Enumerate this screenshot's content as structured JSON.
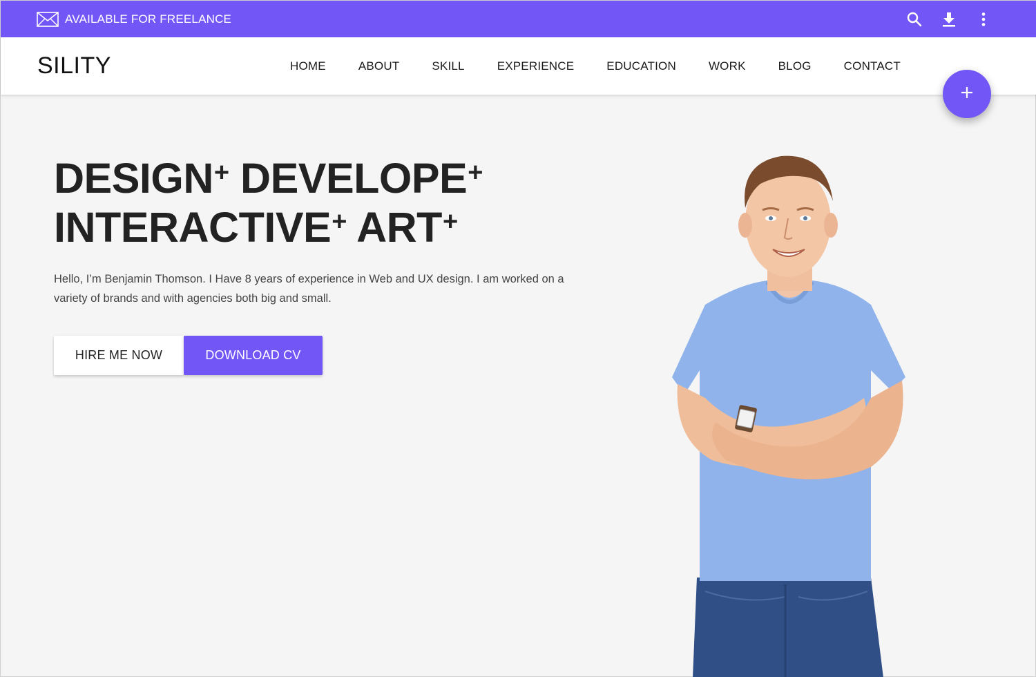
{
  "topbar": {
    "status_text": "AVAILABLE FOR FREELANCE",
    "icons": [
      "mail-icon",
      "search-icon",
      "download-icon",
      "more-vert-icon"
    ],
    "background": "#7357f6"
  },
  "navbar": {
    "logo": "SILITY",
    "items": [
      {
        "label": "HOME"
      },
      {
        "label": "ABOUT"
      },
      {
        "label": "SKILL"
      },
      {
        "label": "EXPERIENCE"
      },
      {
        "label": "EDUCATION"
      },
      {
        "label": "WORK"
      },
      {
        "label": "BLOG"
      },
      {
        "label": "CONTACT"
      }
    ]
  },
  "fab": {
    "icon": "plus-icon",
    "color": "#7357f6"
  },
  "hero": {
    "headline": {
      "word1": "DESIGN",
      "word2": "DEVELOPE",
      "word3": "INTERACTIVE",
      "word4": "ART",
      "plus": "+"
    },
    "intro": "Hello, I’m Benjamin Thomson. I Have 8 years of experience in Web and UX design. I am worked on a variety of brands and with agencies both big and small.",
    "buttons": {
      "hire": "HIRE ME NOW",
      "download": "DOWNLOAD CV"
    }
  },
  "portrait": {
    "icon": "person-photo"
  }
}
